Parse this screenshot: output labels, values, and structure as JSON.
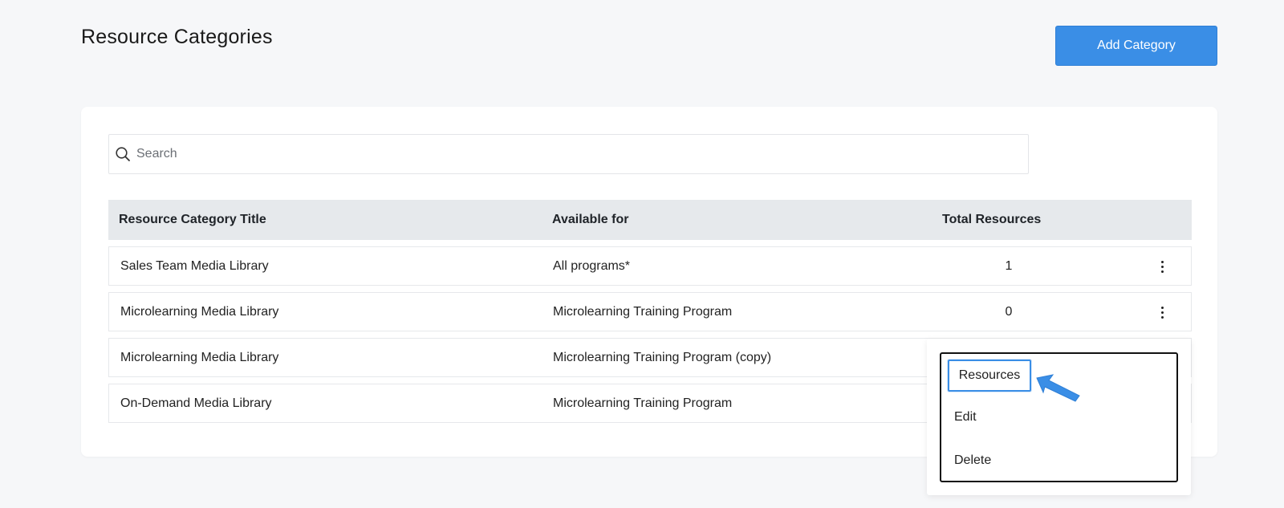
{
  "header": {
    "title": "Resource Categories",
    "add_label": "Add Category"
  },
  "search": {
    "placeholder": "Search",
    "value": ""
  },
  "table": {
    "columns": [
      "Resource Category Title",
      "Available for",
      "Total Resources"
    ],
    "rows": [
      {
        "title": "Sales Team Media Library",
        "available_for": "All programs*",
        "total": "1"
      },
      {
        "title": "Microlearning Media Library",
        "available_for": "Microlearning Training Program",
        "total": "0"
      },
      {
        "title": "Microlearning Media Library",
        "available_for": "Microlearning Training Program (copy)",
        "total": ""
      },
      {
        "title": "On-Demand Media Library",
        "available_for": "Microlearning Training Program",
        "total": ""
      }
    ]
  },
  "context_menu": {
    "items": [
      "Resources",
      "Edit",
      "Delete"
    ],
    "highlighted": "Resources"
  },
  "colors": {
    "accent": "#3a8ee6",
    "header_row": "#e6e9ec",
    "background": "#f6f7f9"
  }
}
